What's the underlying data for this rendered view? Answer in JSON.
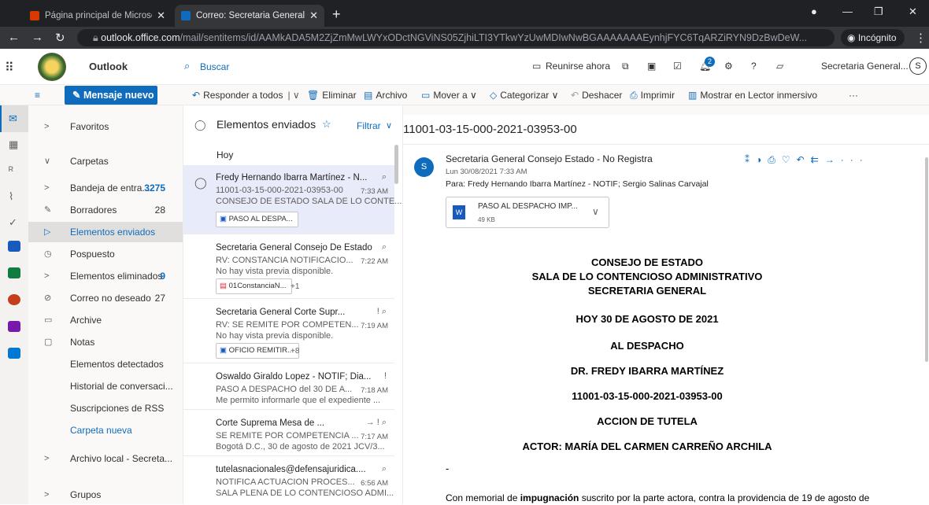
{
  "browser": {
    "tabs": [
      {
        "title": "Página principal de Microsoft Offi",
        "active": false
      },
      {
        "title": "Correo: Secretaria General Conse",
        "active": true
      }
    ],
    "url_host": "outlook.office.com",
    "url_path": "/mail/sentitems/id/AAMkADA5M2ZjZmMwLWYxODctNGViNS05ZjhiLTI3YTkwYzUwMDIwNwBGAAAAAAAEynhjFYC6TqARZiRYN9DzBwDeW...",
    "incognito_label": "Incógnito"
  },
  "header": {
    "app_name": "Outlook",
    "search_placeholder": "Buscar",
    "meet_now": "Reunirse ahora",
    "badge_count": "2",
    "account": "Secretaria General...",
    "avatar_initial": "S"
  },
  "commands": {
    "new_message": "Mensaje nuevo",
    "reply_all": "Responder a todos",
    "delete": "Eliminar",
    "archive": "Archivo",
    "move_to": "Mover a",
    "categorize": "Categorizar",
    "undo": "Deshacer",
    "print": "Imprimir",
    "immersive": "Mostrar en Lector inmersivo"
  },
  "folders": [
    {
      "label": "Favoritos",
      "chev": ">",
      "count": ""
    },
    {
      "label": "Carpetas",
      "chev": "∨",
      "count": ""
    },
    {
      "label": "Bandeja de entra...",
      "chev": ">",
      "count": "3275"
    },
    {
      "label": "Borradores",
      "chev": "✎",
      "count": "28"
    },
    {
      "label": "Elementos enviados",
      "chev": "▷",
      "count": ""
    },
    {
      "label": "Pospuesto",
      "chev": "◷",
      "count": ""
    },
    {
      "label": "Elementos eliminados",
      "chev": ">",
      "count": "9"
    },
    {
      "label": "Correo no deseado",
      "chev": "⊘",
      "count": "27"
    },
    {
      "label": "Archive",
      "chev": "▭",
      "count": ""
    },
    {
      "label": "Notas",
      "chev": "▢",
      "count": ""
    },
    {
      "label": "Elementos detectados",
      "chev": "",
      "count": ""
    },
    {
      "label": "Historial de conversaci...",
      "chev": "",
      "count": ""
    },
    {
      "label": "Suscripciones de RSS",
      "chev": "",
      "count": ""
    },
    {
      "label": "Carpeta nueva",
      "chev": "",
      "count": ""
    },
    {
      "label": "Archivo local - Secreta...",
      "chev": ">",
      "count": ""
    },
    {
      "label": "Grupos",
      "chev": ">",
      "count": ""
    }
  ],
  "list": {
    "title": "Elementos enviados",
    "filter": "Filtrar",
    "group_today": "Hoy",
    "messages": [
      {
        "from": "Fredy Hernando Ibarra Martínez - N...",
        "subject": "11001-03-15-000-2021-03953-00",
        "time": "7:33 AM",
        "preview": "CONSEJO DE ESTADO SALA DE LO CONTE...",
        "attachment": "PASO AL DESPA...",
        "more": "",
        "mark": "⌕"
      },
      {
        "from": "Secretaria General Consejo De Estado",
        "subject": "RV: CONSTANCIA NOTIFICACIO...",
        "time": "7:22 AM",
        "preview": "No hay vista previa disponible.",
        "attachment": "01ConstanciaN...",
        "more": "+1",
        "mark": "⌕"
      },
      {
        "from": "Secretaria General Corte Supr...",
        "subject": "RV: SE REMITE POR COMPETEN...",
        "time": "7:19 AM",
        "preview": "No hay vista previa disponible.",
        "attachment": "OFICIO REMITIR...",
        "more": "+8",
        "mark": "!  ⌕"
      },
      {
        "from": "Oswaldo Giraldo Lopez - NOTIF; Dia...",
        "subject": "PASO A DESPACHO del 30 DE A...",
        "time": "7:18 AM",
        "preview": "Me permito informarle que el expediente ...",
        "attachment": "",
        "more": "",
        "mark": "!"
      },
      {
        "from": "Corte Suprema Mesa de ...",
        "subject": "SE REMITE POR COMPETENCIA ...",
        "time": "7:17 AM",
        "preview": "Bogotá D.C., 30 de agosto de 2021 JCV/3...",
        "attachment": "",
        "more": "",
        "mark": "→  !  ⌕"
      },
      {
        "from": "tutelasnacionales@defensajuridica....",
        "subject": "NOTIFICA ACTUACION PROCES...",
        "time": "6:56 AM",
        "preview": "SALA PLENA DE LO CONTENCIOSO ADMI...",
        "attachment": "",
        "more": "",
        "mark": "⌕"
      }
    ]
  },
  "reader": {
    "subject": "11001-03-15-000-2021-03953-00",
    "sender": "Secretaria General Consejo Estado - No Registra",
    "date": "Lun 30/08/2021 7:33 AM",
    "to": "Para:  Fredy Hernando Ibarra Martínez - NOTIF; Sergio Salinas Carvajal",
    "attachment_name": "PASO AL DESPACHO IMP...",
    "attachment_size": "49 KB",
    "avatar_initial": "S",
    "body": {
      "line1": "CONSEJO DE ESTADO",
      "line2": "SALA DE LO CONTENCIOSO ADMINISTRATIVO",
      "line3": "SECRETARIA GENERAL",
      "line4": "HOY 30 DE AGOSTO DE 2021",
      "line5": "AL DESPACHO",
      "line6": "DR. FREDY IBARRA MARTÍNEZ",
      "line7": "11001-03-15-000-2021-03953-00",
      "line8": "ACCION DE TUTELA",
      "line9": "ACTOR: MARÍA DEL CARMEN CARREÑO ARCHILA",
      "dash": "-",
      "para_pre": "Con memorial de ",
      "para_bold": "impugnación",
      "para_post": " suscrito por la parte actora, contra la providencia de 19 de agosto de"
    }
  },
  "colors": {
    "accent": "#0f6cbd",
    "selected_bg": "#e8ebfa"
  }
}
